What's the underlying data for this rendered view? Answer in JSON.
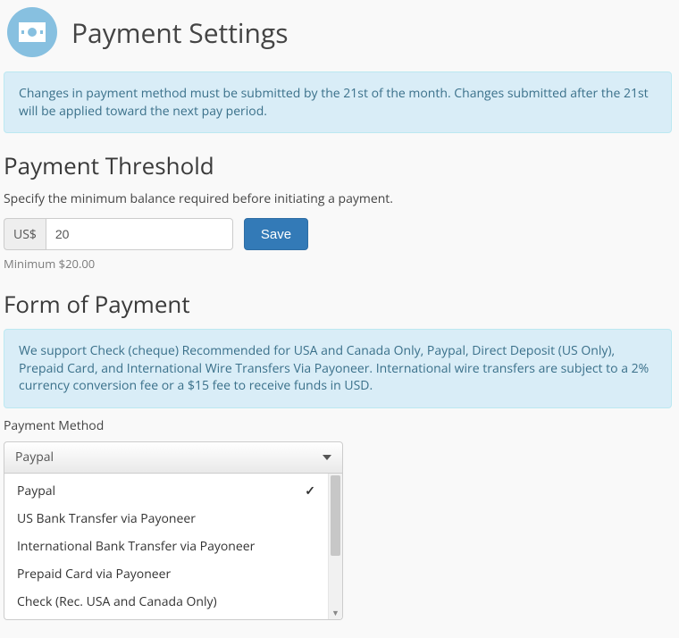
{
  "header": {
    "title": "Payment Settings"
  },
  "notices": {
    "deadline": "Changes in payment method must be submitted by the 21st of the month. Changes submitted after the 21st will be applied toward the next pay period.",
    "methods": "We support Check (cheque) Recommended for USA and Canada Only, Paypal, Direct Deposit (US Only), Prepaid Card, and International Wire Transfers Via Payoneer. International wire transfers are subject to a 2% currency conversion fee or a $15 fee to receive funds in USD."
  },
  "threshold": {
    "section_title": "Payment Threshold",
    "description": "Specify the minimum balance required before initiating a payment.",
    "currency_prefix": "US$",
    "value": "20",
    "save_label": "Save",
    "hint": "Minimum $20.00"
  },
  "form_of_payment": {
    "section_title": "Form of Payment",
    "field_label": "Payment Method",
    "selected": "Paypal",
    "options": [
      "Paypal",
      "US Bank Transfer via Payoneer",
      "International Bank Transfer via Payoneer",
      "Prepaid Card via Payoneer",
      "Check (Rec. USA and Canada Only)"
    ]
  }
}
